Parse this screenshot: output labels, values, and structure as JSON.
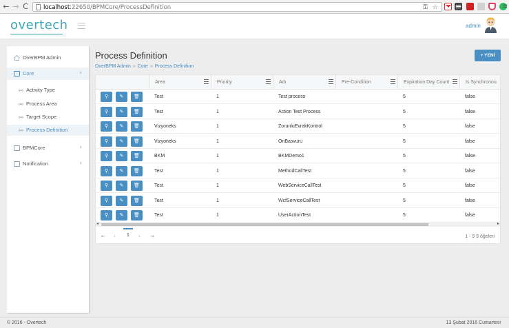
{
  "browser": {
    "url_host": "localhost",
    "url_path": ":22650/BPMCore/ProcessDefinition"
  },
  "header": {
    "logo": "overtech",
    "user": "admin"
  },
  "sidebar": {
    "items": [
      {
        "label": "OverBPM Admin",
        "icon": "home-icon"
      },
      {
        "label": "Core",
        "icon": "folder-icon"
      },
      {
        "label": "BPMCore",
        "icon": "folder-icon"
      },
      {
        "label": "Notification",
        "icon": "folder-icon"
      }
    ],
    "sub_items": [
      {
        "label": "Activity Type",
        "icon": "link-icon"
      },
      {
        "label": "Process Area",
        "icon": "link-icon"
      },
      {
        "label": "Target Scope",
        "icon": "link-icon"
      },
      {
        "label": "Process Definition",
        "icon": "link-icon"
      }
    ]
  },
  "main": {
    "title": "Process Definition",
    "breadcrumb": [
      "OverBPM Admin",
      "Core",
      "Process Definition"
    ],
    "new_button": "+ YENİ"
  },
  "grid": {
    "columns": [
      "Area",
      "Priority",
      "Adı",
      "Pre-Condition",
      "Expiration Day Count",
      "Is Synchronou"
    ],
    "rows": [
      [
        "Test",
        "1",
        "Test process",
        "",
        "5",
        "false"
      ],
      [
        "Test",
        "1",
        "Action Test Process",
        "",
        "5",
        "false"
      ],
      [
        "Vizyoneks",
        "1",
        "ZorunluEvrakKontrol",
        "",
        "5",
        "false"
      ],
      [
        "Vizyoneks",
        "1",
        "OnBasvuru",
        "",
        "5",
        "false"
      ],
      [
        "BKM",
        "1",
        "BKMDemo1",
        "",
        "5",
        "false"
      ],
      [
        "Test",
        "1",
        "MethodCallTest",
        "",
        "5",
        "false"
      ],
      [
        "Test",
        "1",
        "WebServiceCallTest",
        "",
        "5",
        "false"
      ],
      [
        "Test",
        "1",
        "WcfServiceCallTest",
        "",
        "5",
        "false"
      ],
      [
        "Test",
        "1",
        "UserActionTest",
        "",
        "5",
        "false"
      ]
    ],
    "pager": {
      "current_page": "1",
      "info": "1 - 9 9 öğeleri"
    }
  },
  "footer": {
    "copyright": "© 2016 - Overtech",
    "date": "13 Şubat 2016 Cumartesi"
  },
  "colors": {
    "accent": "#4a8fc4",
    "logo": "#3aa6b9"
  }
}
